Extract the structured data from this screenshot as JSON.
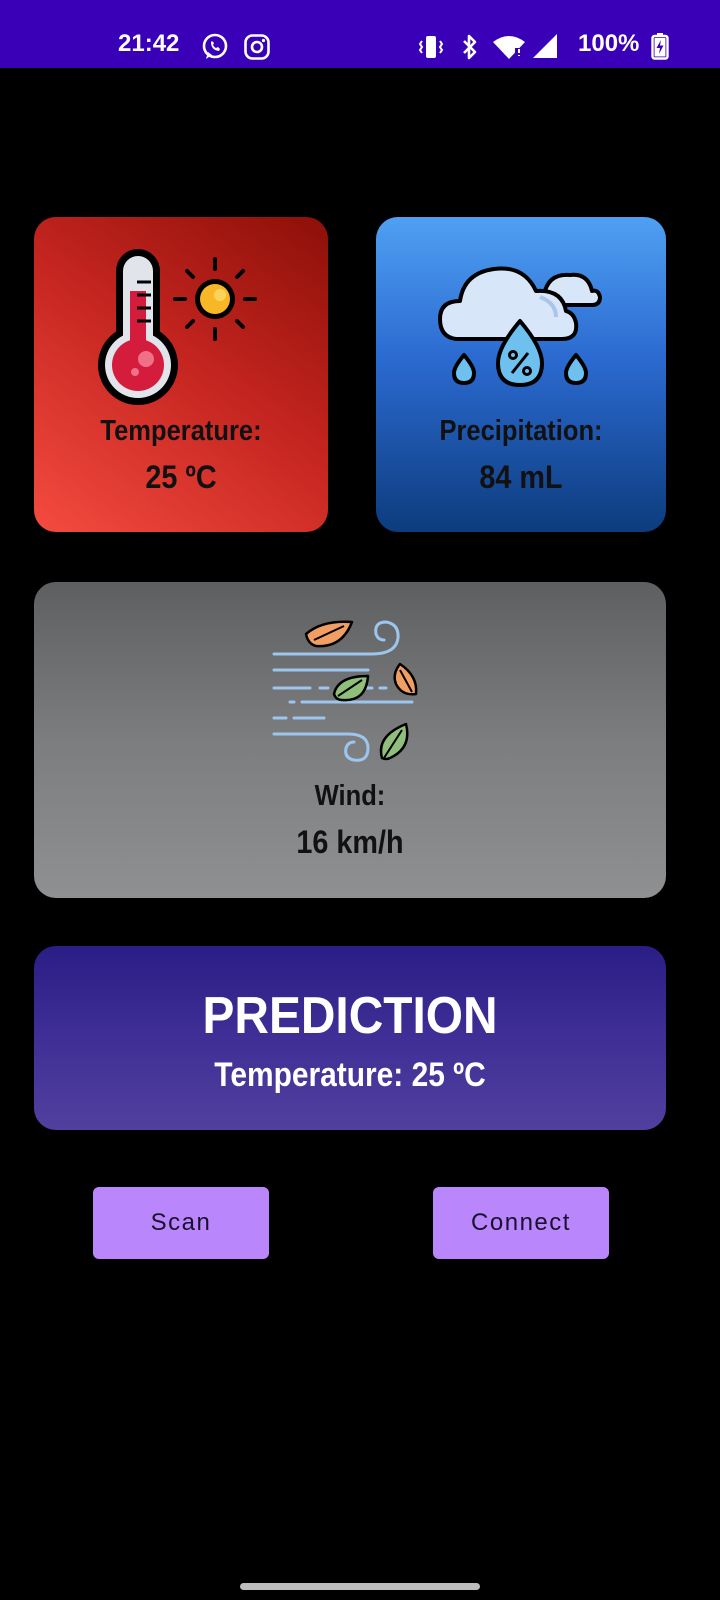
{
  "status_bar": {
    "time": "21:42",
    "battery": "100%",
    "icons": [
      "whatsapp-icon",
      "instagram-icon",
      "vibrate-icon",
      "bluetooth-icon",
      "wifi-icon",
      "signal-icon",
      "battery-charging-icon"
    ],
    "background": "#3a00b8"
  },
  "cards": {
    "temperature": {
      "label": "Temperature:",
      "value": "25 ºC",
      "icon": "thermometer-sun-icon"
    },
    "precipitation": {
      "label": "Precipitation:",
      "value": "84 mL",
      "icon": "cloud-humidity-icon"
    },
    "wind": {
      "label": "Wind:",
      "value": "16 km/h",
      "icon": "wind-leaves-icon"
    }
  },
  "prediction": {
    "title": "PREDICTION",
    "value": "Temperature: 25 ºC"
  },
  "buttons": {
    "scan": "Scan",
    "connect": "Connect"
  },
  "colors": {
    "button": "#b987fb",
    "temperature_card": "#d7322a",
    "precipitation_card": "#2b6ad0",
    "wind_card": "#7c7d7f",
    "prediction_card": "#3f2f96"
  }
}
